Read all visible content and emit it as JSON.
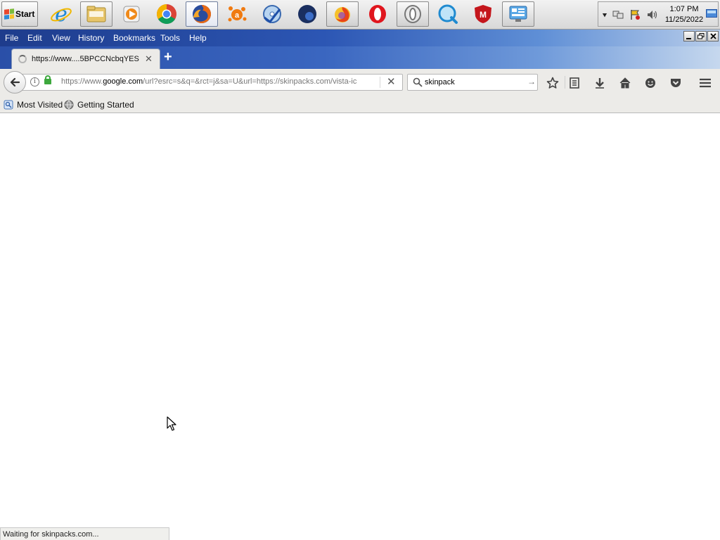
{
  "taskbar": {
    "start_label": "Start",
    "pinned_icons": [
      "internet-explorer-icon",
      "file-explorer-icon",
      "media-player-icon",
      "chrome-icon",
      "firefox-icon",
      "avast-icon",
      "disc-burner-icon",
      "waterfox-icon",
      "firefox-alt-icon",
      "opera-icon",
      "opera-alt-icon",
      "quicktime-icon",
      "mcafee-icon",
      "control-panel-icon"
    ],
    "active_icon": "firefox-icon",
    "clock_time": "1:07 PM",
    "clock_date": "11/25/2022"
  },
  "menubar": {
    "items": [
      "File",
      "Edit",
      "View",
      "History",
      "Bookmarks",
      "Tools",
      "Help"
    ]
  },
  "tab": {
    "title": "https://www....5BPCCNcbqYES"
  },
  "urlbar": {
    "prefix": "https://www.",
    "host": "google.com",
    "path": "/url?esrc=s&q=&rct=j&sa=U&url=https://skinpacks.com/vista-ic"
  },
  "search": {
    "value": "skinpack"
  },
  "bookmarks": [
    "Most Visited",
    "Getting Started"
  ],
  "status": {
    "text": "Waiting for skinpacks.com..."
  },
  "colors": {
    "titlebar_blue": "#2c56b4",
    "lock_green": "#3ea83e"
  }
}
